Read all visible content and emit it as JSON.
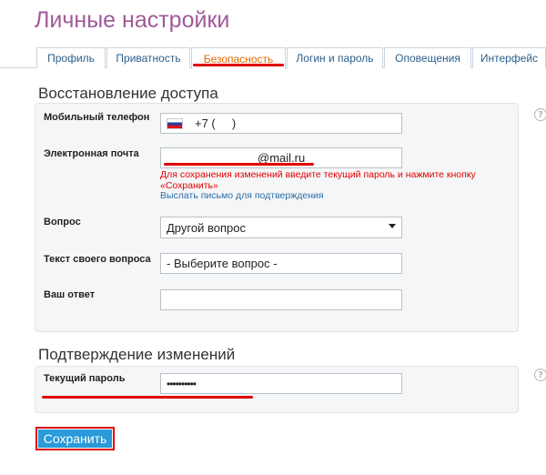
{
  "page_title": "Личные настройки",
  "tabs": [
    {
      "label": "Профиль"
    },
    {
      "label": "Приватность"
    },
    {
      "label": "Безопасность",
      "active": true
    },
    {
      "label": "Логин и пароль"
    },
    {
      "label": "Оповещения"
    },
    {
      "label": "Интерфейс"
    }
  ],
  "access_recovery": {
    "title": "Восстановление доступа",
    "phone": {
      "label": "Мобильный телефон",
      "value": "+7 (     )"
    },
    "email": {
      "label": "Электронная почта",
      "value": "@mail.ru",
      "warning": "Для сохранения изменений введите текущий пароль и нажмите кнопку «Сохранить»",
      "confirm_link": "Выслать письмо для подтверждения"
    },
    "question": {
      "label": "Вопрос",
      "value": "Другой вопрос"
    },
    "custom_question": {
      "label": "Текст своего вопроса",
      "value": "- Выберите вопрос -"
    },
    "answer": {
      "label": "Ваш ответ",
      "value": ""
    }
  },
  "confirm_changes": {
    "title": "Подтверждение изменений",
    "password": {
      "label": "Текущий пароль",
      "value": "••••••••••"
    }
  },
  "save_label": "Сохранить",
  "help_symbol": "?",
  "colors": {
    "accent": "#e00000",
    "title": "#a05a9a",
    "button": "#2a9ad8",
    "link": "#2b6ea8"
  }
}
